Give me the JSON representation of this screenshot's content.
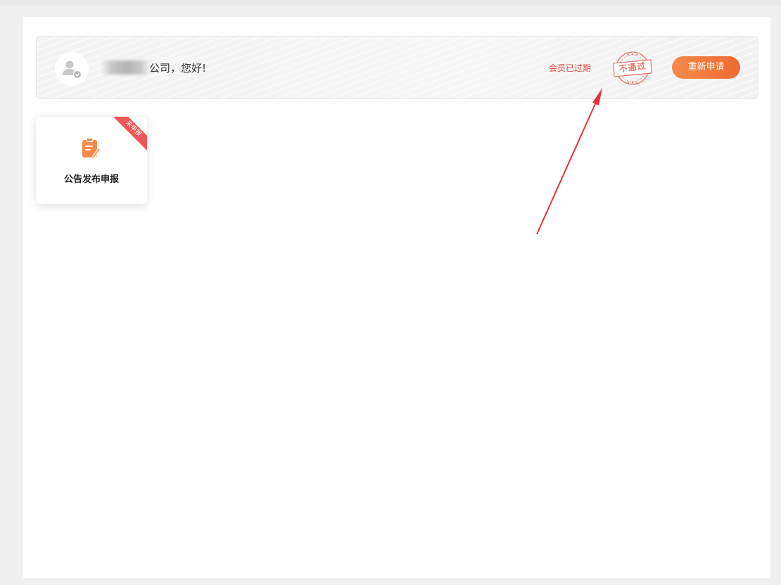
{
  "header": {
    "greeting": "公司，您好!",
    "member_status": "会员已过期",
    "stamp_text": "不通过",
    "reapply_button": "重新申请"
  },
  "cards": [
    {
      "title": "公告发布申报",
      "badge": "未申报",
      "icon": "clipboard-edit-icon"
    }
  ],
  "colors": {
    "accent_orange": "#ee6a33",
    "status_red": "#e34b3c",
    "badge_red": "#f0555a",
    "annotation_arrow": "#e8333a"
  }
}
